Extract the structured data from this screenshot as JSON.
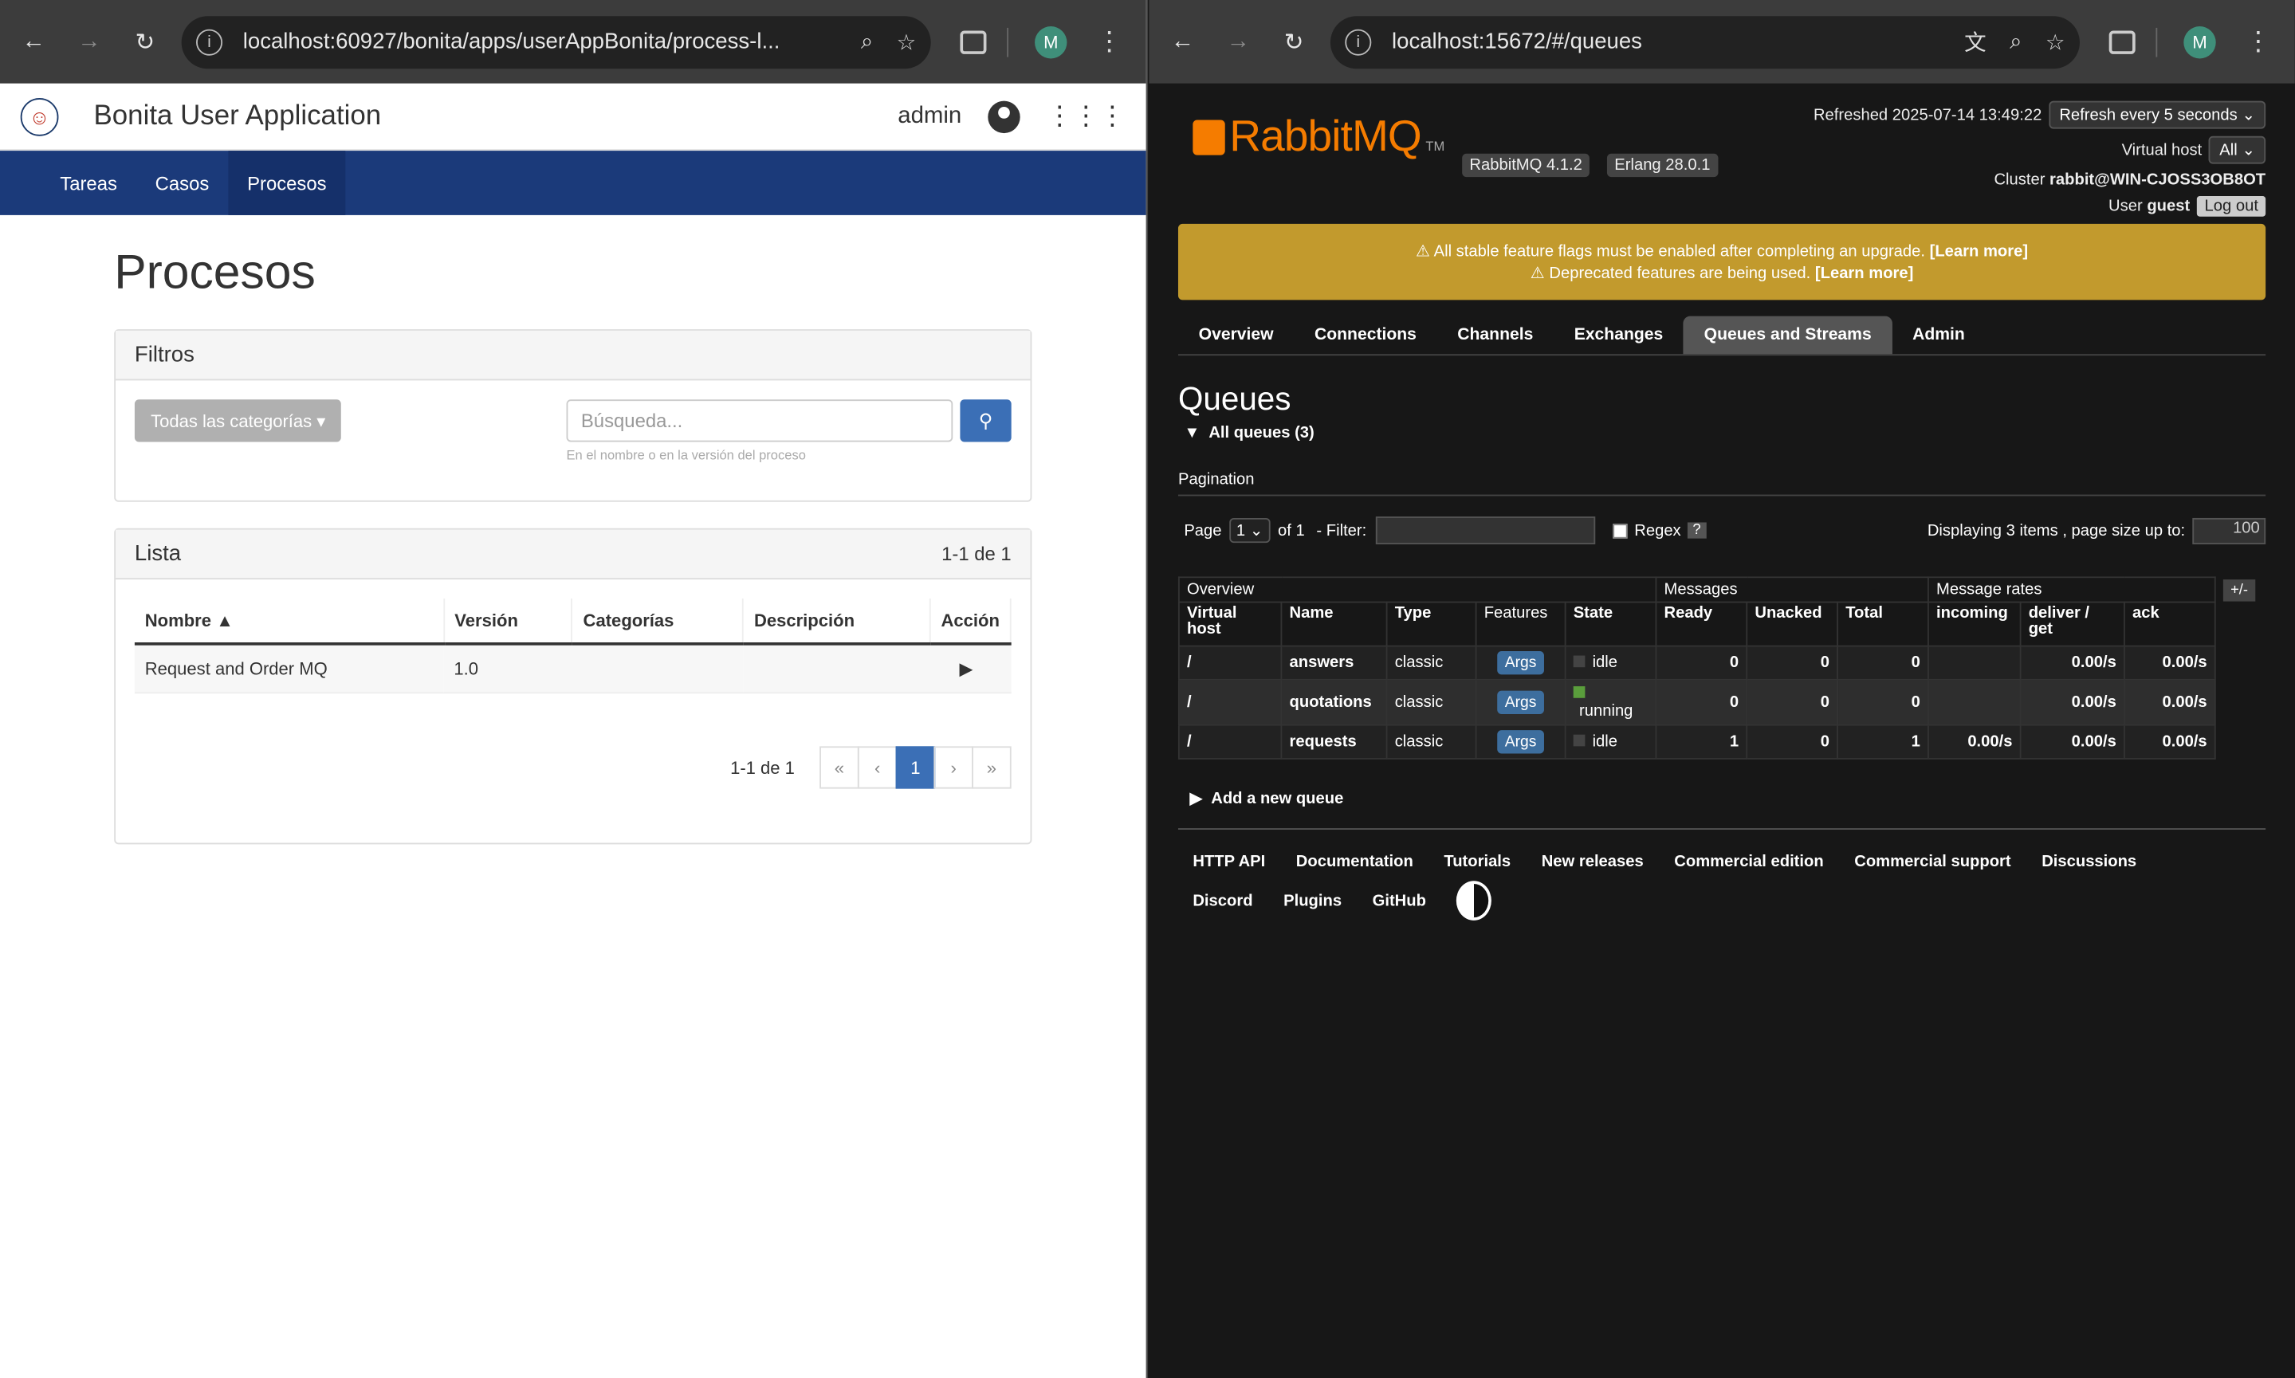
{
  "left_browser": {
    "url": "localhost:60927/bonita/apps/userAppBonita/process-l...",
    "profile_initial": "M"
  },
  "right_browser": {
    "url": "localhost:15672/#/queues",
    "profile_initial": "M"
  },
  "bonita": {
    "title": "Bonita User Application",
    "user": "admin",
    "nav": [
      "Tareas",
      "Casos",
      "Procesos"
    ],
    "active_nav": "Procesos",
    "page_title": "Procesos",
    "filters": {
      "heading": "Filtros",
      "category_button": "Todas las categorías ▾",
      "search_placeholder": "Búsqueda...",
      "search_help": "En el nombre o en la versión del proceso"
    },
    "list": {
      "heading": "Lista",
      "count": "1-1 de 1",
      "columns": [
        "Nombre ▲",
        "Versión",
        "Categorías",
        "Descripción",
        "Acción"
      ],
      "rows": [
        {
          "name": "Request and Order MQ",
          "version": "1.0",
          "categories": "",
          "description": "",
          "action": "▶"
        }
      ],
      "pager_count": "1-1 de 1",
      "pager": [
        "«",
        "‹",
        "1",
        "›",
        "»"
      ]
    }
  },
  "rabbit": {
    "logo_text": "RabbitMQ",
    "logo_tm": "TM",
    "version_badge": "RabbitMQ 4.1.2",
    "erlang_badge": "Erlang 28.0.1",
    "refreshed": "Refreshed 2025-07-14 13:49:22",
    "refresh_select": "Refresh every 5 seconds",
    "vhost_label": "Virtual host",
    "vhost_value": "All",
    "cluster_label": "Cluster",
    "cluster_value": "rabbit@WIN-CJOSS3OB8OT",
    "user_label": "User",
    "user_value": "guest",
    "logout": "Log out",
    "warning_1": "⚠ All stable feature flags must be enabled after completing an upgrade.",
    "warning_2": "⚠ Deprecated features are being used.",
    "learn_more": "[Learn more]",
    "tabs": [
      "Overview",
      "Connections",
      "Channels",
      "Exchanges",
      "Queues and Streams",
      "Admin"
    ],
    "active_tab": "Queues and Streams",
    "heading": "Queues",
    "all_queues": "All queues (3)",
    "pagination_label": "Pagination",
    "page_label": "Page",
    "page_value": "1",
    "of_label": "of 1",
    "filter_label": "- Filter:",
    "regex_label": "Regex",
    "regex_help": "?",
    "displaying": "Displaying 3 items , page size up to:",
    "page_size": "100",
    "group_headers": [
      "Overview",
      "Messages",
      "Message rates"
    ],
    "plusminus": "+/-",
    "columns": [
      "Virtual host",
      "Name",
      "Type",
      "Features",
      "State",
      "Ready",
      "Unacked",
      "Total",
      "incoming",
      "deliver / get",
      "ack"
    ],
    "queues": [
      {
        "vhost": "/",
        "name": "answers",
        "type": "classic",
        "features": "Args",
        "state": "idle",
        "ready": "0",
        "unacked": "0",
        "total": "0",
        "incoming": "",
        "deliver": "0.00/s",
        "ack": "0.00/s"
      },
      {
        "vhost": "/",
        "name": "quotations",
        "type": "classic",
        "features": "Args",
        "state": "running",
        "ready": "0",
        "unacked": "0",
        "total": "0",
        "incoming": "",
        "deliver": "0.00/s",
        "ack": "0.00/s"
      },
      {
        "vhost": "/",
        "name": "requests",
        "type": "classic",
        "features": "Args",
        "state": "idle",
        "ready": "1",
        "unacked": "0",
        "total": "1",
        "incoming": "0.00/s",
        "deliver": "0.00/s",
        "ack": "0.00/s"
      }
    ],
    "add_queue": "Add a new queue",
    "footer_links": [
      "HTTP API",
      "Documentation",
      "Tutorials",
      "New releases",
      "Commercial edition",
      "Commercial support",
      "Discussions",
      "Discord",
      "Plugins",
      "GitHub"
    ]
  }
}
